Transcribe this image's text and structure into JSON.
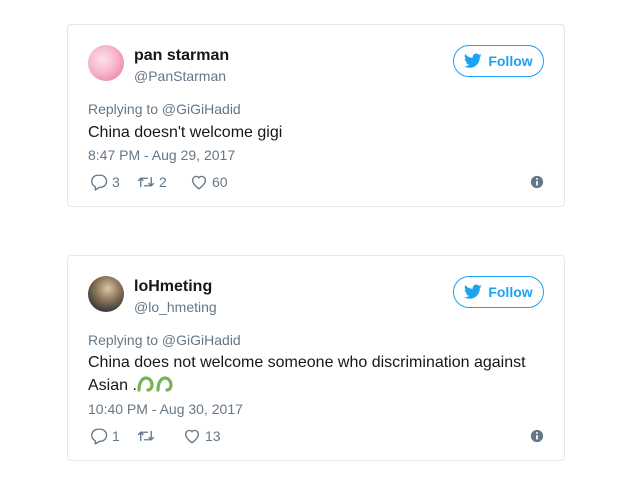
{
  "tweets": [
    {
      "display_name": "pan starman",
      "handle": "@PanStarman",
      "follow_label": "Follow",
      "replying_to": "Replying to @GiGiHadid",
      "text": "China doesn't welcome gigi",
      "timestamp": "8:47 PM - Aug 29, 2017",
      "replies": "3",
      "retweets": "2",
      "likes": "60"
    },
    {
      "display_name": "loHmeting",
      "handle": "@lo_hmeting",
      "follow_label": "Follow",
      "replying_to": "Replying to @GiGiHadid",
      "text": "China does not welcome someone who discrimination against Asian .",
      "emoji": "🐍🐍",
      "timestamp": "10:40 PM - Aug 30, 2017",
      "replies": "1",
      "retweets": "",
      "likes": "13"
    }
  ],
  "icons": {
    "follow": "twitter-bird-icon",
    "reply": "reply-bubble-icon",
    "retweet": "retweet-icon",
    "like": "heart-icon",
    "info": "info-icon"
  },
  "colors": {
    "accent": "#1da1f2",
    "secondary_text": "#657786",
    "border": "#e1e8ed",
    "emoji_green": "#77b255"
  }
}
